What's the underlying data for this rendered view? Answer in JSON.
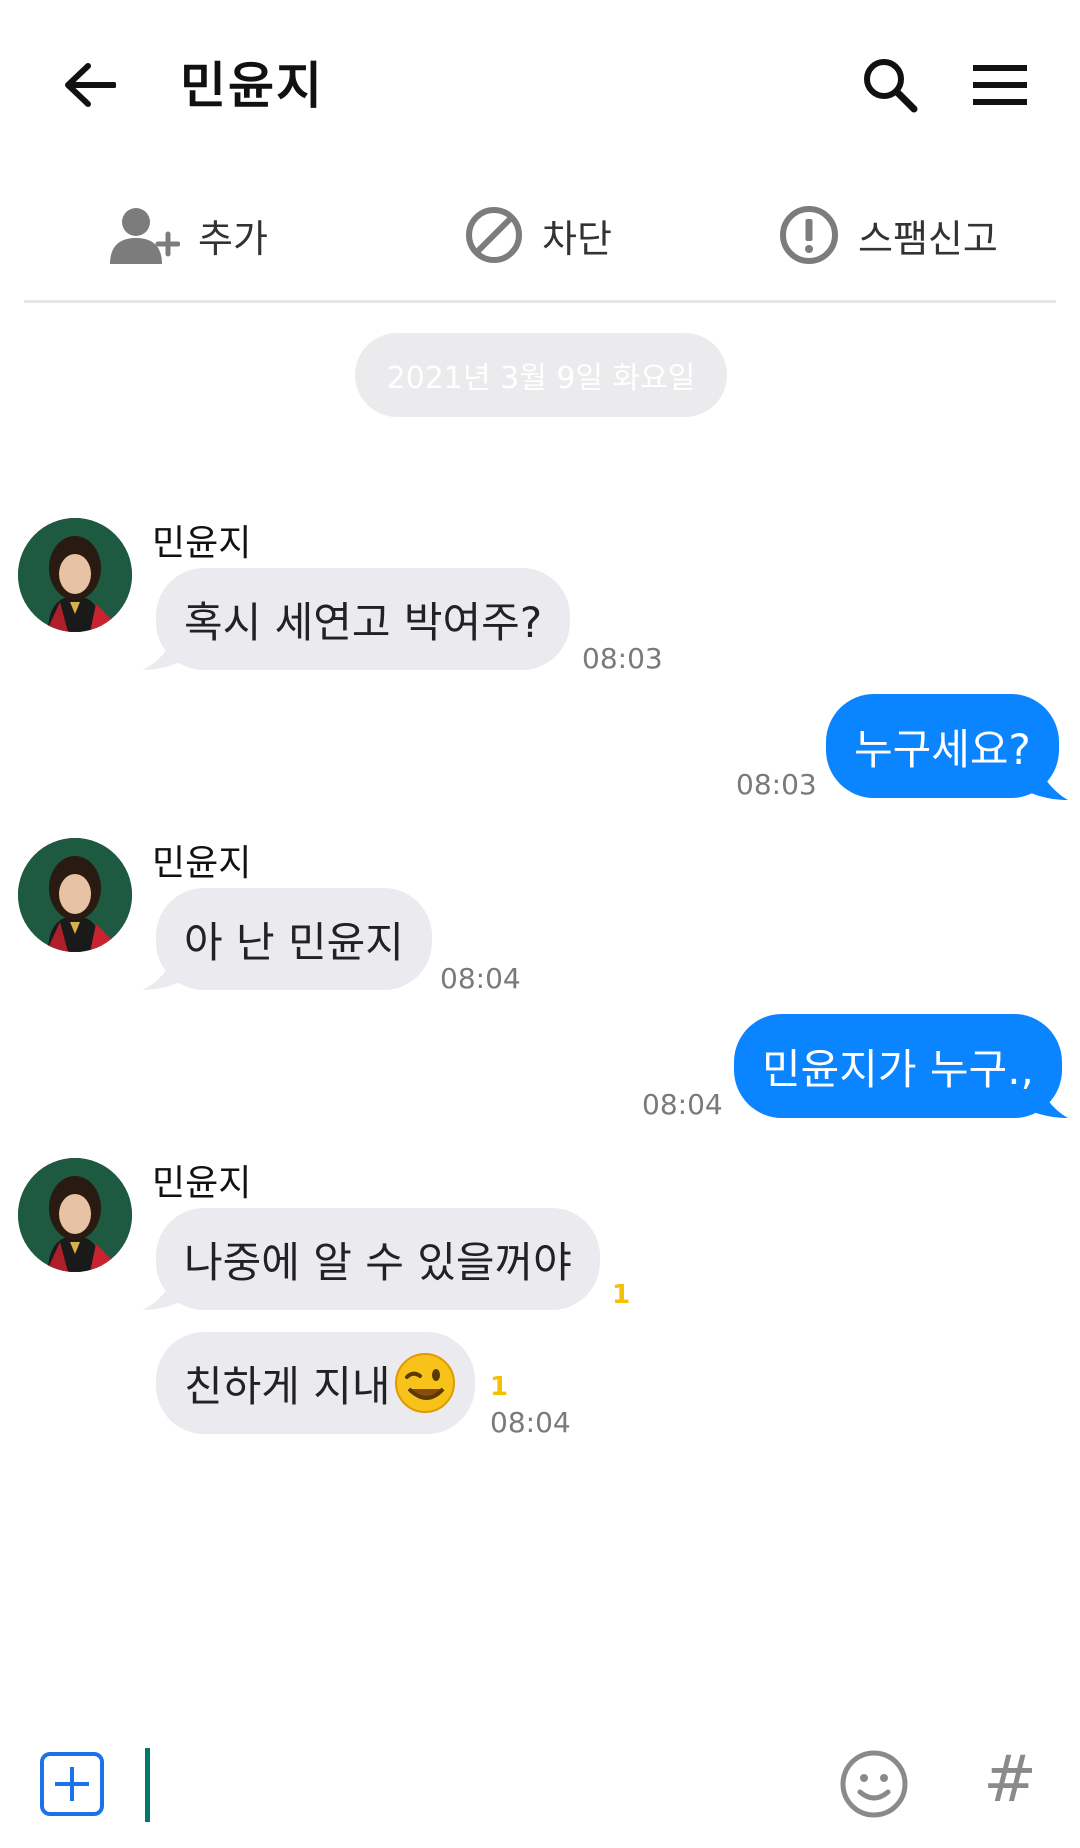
{
  "header": {
    "title": "민윤지",
    "back_icon": "arrow-left-icon",
    "search_icon": "search-icon",
    "menu_icon": "hamburger-menu-icon"
  },
  "actions": {
    "add_label": "추가",
    "block_label": "차단",
    "spam_label": "스팸신고"
  },
  "date_separator": "2021년 3월 9일 화요일",
  "messages": [
    {
      "side": "in",
      "sender": "민윤지",
      "text": "혹시 세연고 박여주?",
      "time": "08:03"
    },
    {
      "side": "out",
      "text": "누구세요?",
      "time": "08:03"
    },
    {
      "side": "in",
      "sender": "민윤지",
      "text": "아 난 민윤지",
      "time": "08:04"
    },
    {
      "side": "out",
      "text": "민윤지가 누구.,",
      "time": "08:04"
    },
    {
      "side": "in",
      "sender": "민윤지",
      "text": "나중에 알 수 있을꺼야",
      "unread": "1"
    },
    {
      "side": "in",
      "text": "친하게 지내",
      "emoji": "winking-face-icon",
      "unread": "1",
      "time": "08:04"
    }
  ],
  "colors": {
    "outgoing_bubble": "#0a84ff",
    "incoming_bubble": "#ebebef",
    "unread_badge": "#f2c200",
    "cursor": "#00796b"
  }
}
